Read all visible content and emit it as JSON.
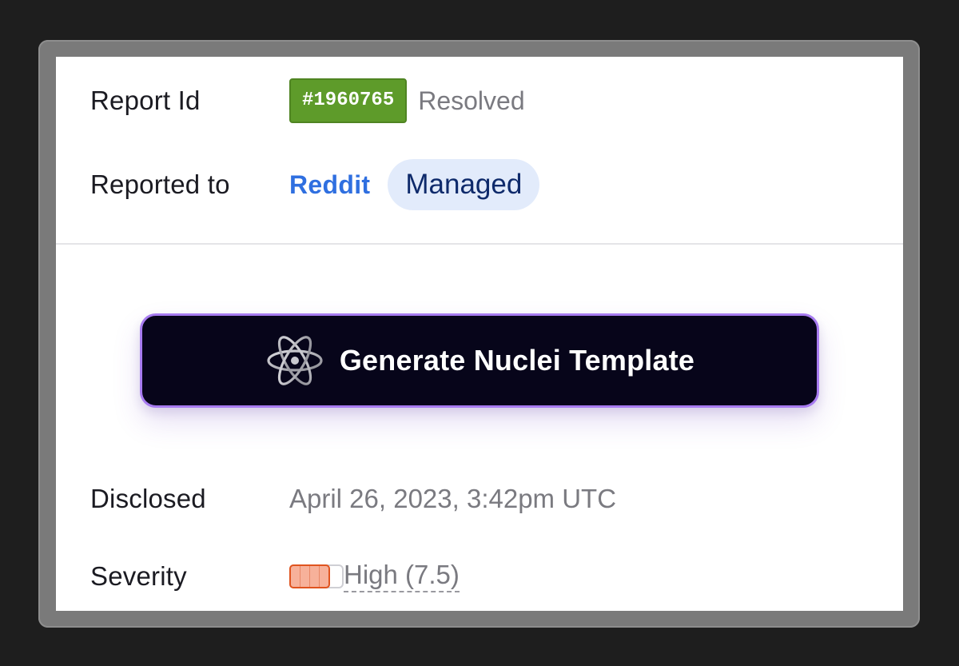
{
  "report": {
    "id_label": "Report Id",
    "id_value": "#1960765",
    "status": "Resolved",
    "badge_color": "#5e9b2a"
  },
  "reported_to": {
    "label": "Reported to",
    "program": "Reddit",
    "tag": "Managed"
  },
  "action": {
    "button_label": "Generate Nuclei Template",
    "icon": "atom-icon"
  },
  "disclosed": {
    "label": "Disclosed",
    "value": "April 26, 2023, 3:42pm UTC"
  },
  "severity": {
    "label": "Severity",
    "text": "High (7.5)",
    "level_fraction": 0.75,
    "color": "#e0541f"
  }
}
